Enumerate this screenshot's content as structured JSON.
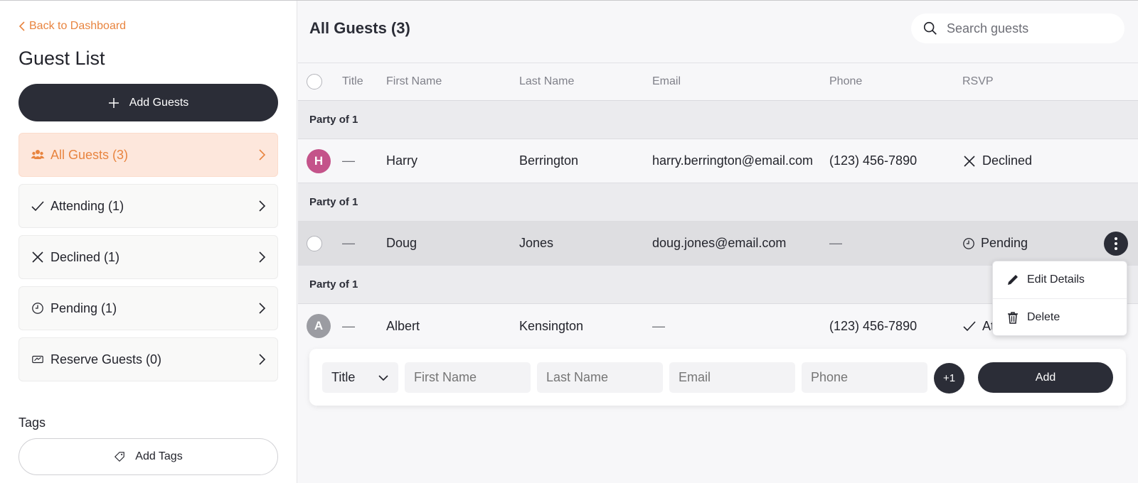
{
  "sidebar": {
    "back_label": "Back to Dashboard",
    "title": "Guest List",
    "add_guests_label": "Add Guests",
    "nav": [
      {
        "label": "All Guests (3)",
        "icon": "people-icon",
        "active": true
      },
      {
        "label": "Attending (1)",
        "icon": "check-icon",
        "active": false
      },
      {
        "label": "Declined (1)",
        "icon": "x-icon",
        "active": false
      },
      {
        "label": "Pending (1)",
        "icon": "clock-icon",
        "active": false
      },
      {
        "label": "Reserve Guests (0)",
        "icon": "ticket-icon",
        "active": false
      }
    ],
    "tags_title": "Tags",
    "add_tags_label": "Add Tags"
  },
  "main": {
    "title": "All Guests (3)",
    "search_placeholder": "Search guests",
    "columns": [
      "Title",
      "First Name",
      "Last Name",
      "Email",
      "Phone",
      "RSVP"
    ],
    "groups": [
      {
        "label": "Party of 1",
        "guest": {
          "avatar": "H",
          "avatar_color": "#c4538a",
          "title": "—",
          "first": "Harry",
          "last": "Berrington",
          "email": "harry.berrington@email.com",
          "phone": "(123) 456-7890",
          "rsvp": "Declined",
          "rsvp_icon": "x-icon"
        }
      },
      {
        "label": "Party of 1",
        "guest": {
          "avatar": "",
          "title": "—",
          "first": "Doug",
          "last": "Jones",
          "email": "doug.jones@email.com",
          "phone": "—",
          "rsvp": "Pending",
          "rsvp_icon": "clock-icon"
        }
      },
      {
        "label": "Party of 1",
        "guest": {
          "avatar": "A",
          "avatar_color": "#9b9ca2",
          "title": "—",
          "first": "Albert",
          "last": "Kensington",
          "email": "—",
          "phone": "(123) 456-7890",
          "rsvp": "Attending",
          "rsvp_visible": "At",
          "rsvp_icon": "check-icon"
        }
      }
    ],
    "context_menu": {
      "edit_label": "Edit Details",
      "delete_label": "Delete"
    },
    "add_row": {
      "title_value": "Title",
      "first_placeholder": "First Name",
      "last_placeholder": "Last Name",
      "email_placeholder": "Email",
      "phone_placeholder": "Phone",
      "plus_one_label": "+1",
      "add_label": "Add"
    }
  },
  "colors": {
    "accent": "#e8843f",
    "dark": "#2b2d37",
    "active_bg": "#fde7dc"
  }
}
